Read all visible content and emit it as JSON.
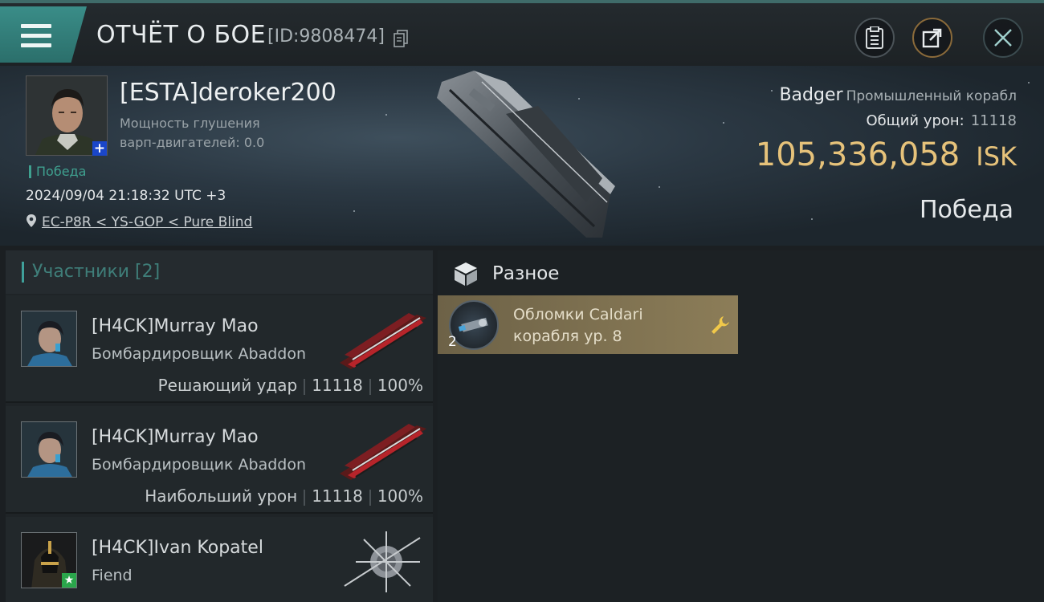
{
  "header": {
    "title": "ОТЧЁТ О БОЕ",
    "report_id": "[ID:9808474]",
    "menu_icon": "hamburger-menu-icon",
    "buttons": [
      "clipboard-icon",
      "share-icon",
      "close-icon"
    ]
  },
  "victim": {
    "name": "[ESTA]deroker200",
    "jam_line1": "Мощность глушения",
    "jam_line2": "варп-двигателей: 0.0",
    "result_tag": "Победа",
    "datetime": "2024/09/04 21:18:32 UTC +3",
    "location": "EC-P8R < YS-GOP < Pure Blind",
    "ship_name": "Badger",
    "ship_class": "Промышленный корабл",
    "damage_label": "Общий урон:",
    "damage_value": "11118",
    "isk_value": "105,336,058",
    "isk_currency": "ISK",
    "result_big": "Победа"
  },
  "participants": {
    "title": "Участники [2]",
    "items": [
      {
        "name": "[H4CK]Murray Mao",
        "ship": "Бомбардировщик Abaddon",
        "role": "Решающий удар",
        "damage": "11118",
        "percent": "100%"
      },
      {
        "name": "[H4CK]Murray Mao",
        "ship": "Бомбардировщик Abaddon",
        "role": "Наибольший урон",
        "damage": "11118",
        "percent": "100%"
      },
      {
        "name": "[H4CK]Ivan Kopatel",
        "ship": "Fiend"
      }
    ]
  },
  "misc": {
    "title": "Разное",
    "items": [
      {
        "name_line1": "Обломки Caldari",
        "name_line2": "корабля ур. 8",
        "quantity": "2"
      }
    ]
  },
  "colors": {
    "accent_teal": "#3a8d88",
    "isk_gold": "#e6c27a",
    "victory_green": "#3fa08f",
    "item_gold": "#8c7d58"
  }
}
